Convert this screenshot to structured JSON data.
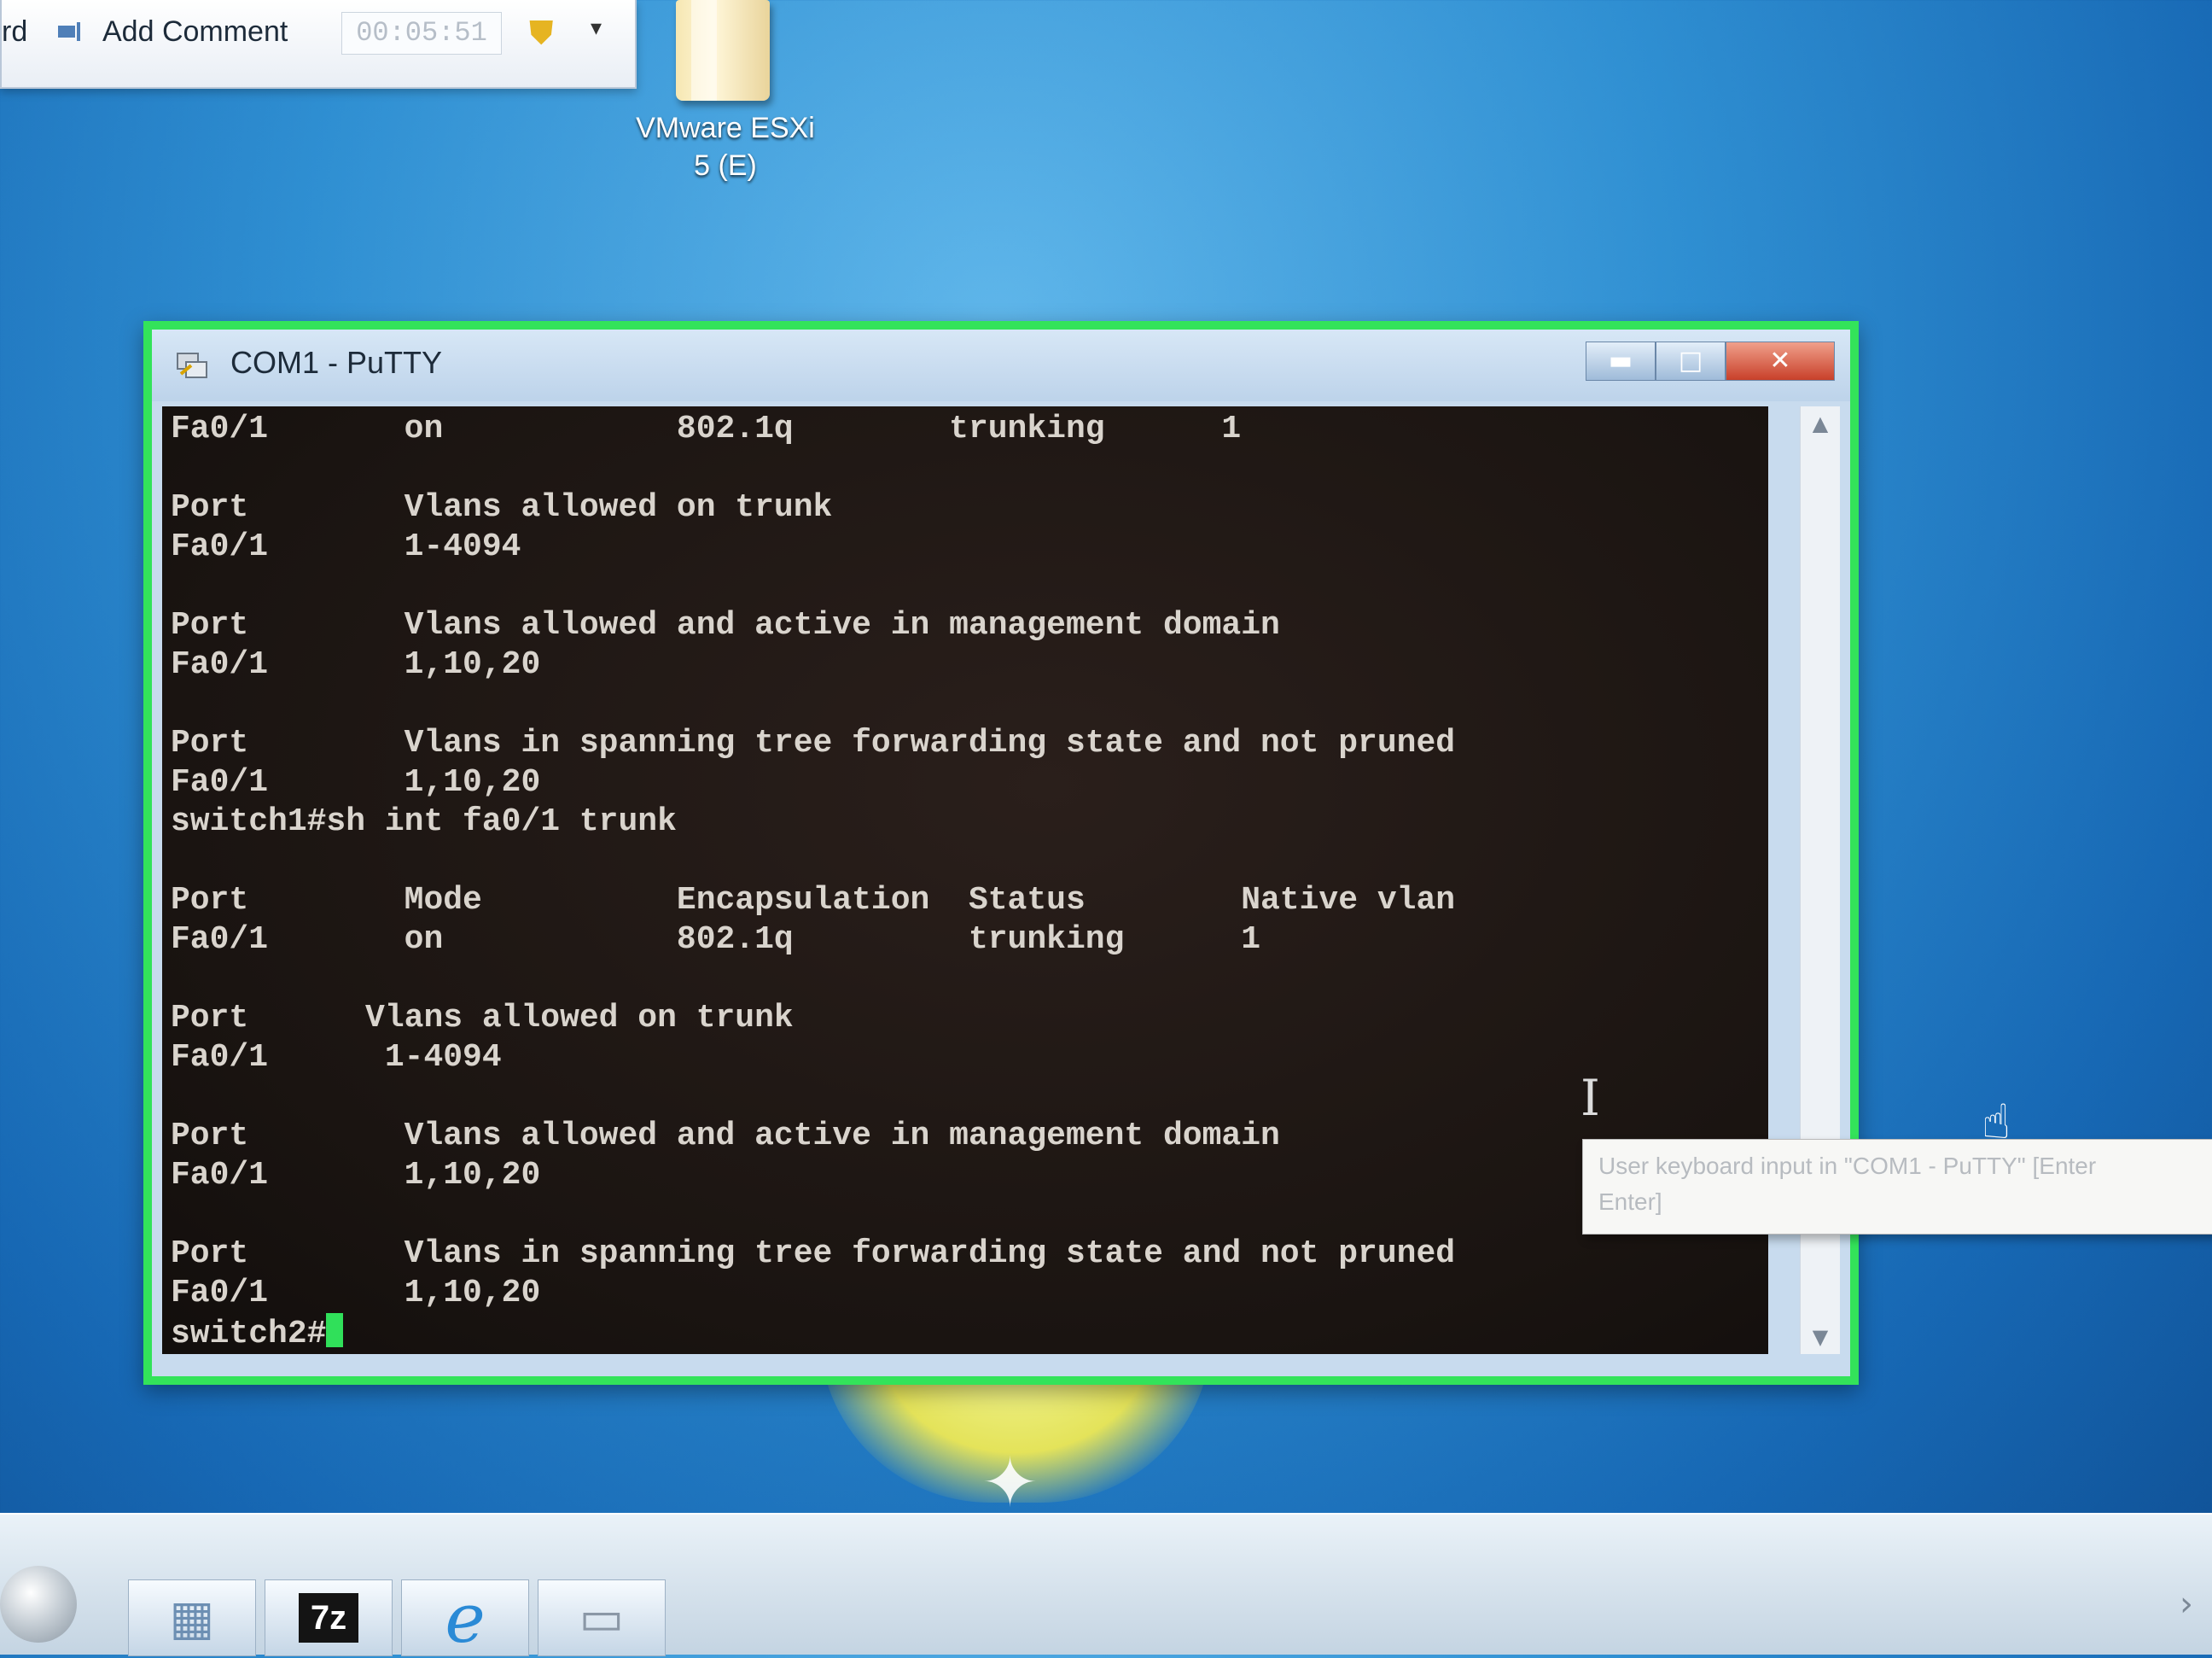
{
  "toolbar": {
    "partial_label": "rd",
    "add_comment_label": "Add Comment",
    "timer": "00:05:51",
    "dropdown_glyph": "▾"
  },
  "desktop": {
    "icon_label_line1": "VMware ESXi",
    "icon_label_line2": "5 (E)"
  },
  "putty": {
    "title": "COM1 - PuTTY",
    "minimize_glyph": "▬",
    "maximize_glyph": "□",
    "close_glyph": "✕",
    "accent_color": "#33e35a",
    "terminal_lines": [
      "Fa0/1       on            802.1q        trunking      1",
      "",
      "Port        Vlans allowed on trunk",
      "Fa0/1       1-4094",
      "",
      "Port        Vlans allowed and active in management domain",
      "Fa0/1       1,10,20",
      "",
      "Port        Vlans in spanning tree forwarding state and not pruned",
      "Fa0/1       1,10,20",
      "switch1#sh int fa0/1 trunk",
      "",
      "Port        Mode          Encapsulation  Status        Native vlan",
      "Fa0/1       on            802.1q         trunking      1",
      "",
      "Port      Vlans allowed on trunk",
      "Fa0/1      1-4094",
      "",
      "Port        Vlans allowed and active in management domain",
      "Fa0/1       1,10,20",
      "",
      "Port        Vlans in spanning tree forwarding state and not pruned",
      "Fa0/1       1,10,20"
    ],
    "prompt": "switch2#"
  },
  "tooltip": {
    "line1": "User keyboard input in \"COM1 - PuTTY\" [Enter",
    "line2": "Enter]"
  },
  "taskbar": {
    "sevenzip_label": "7z",
    "ie_label": "e",
    "tray_arrow": "›"
  }
}
